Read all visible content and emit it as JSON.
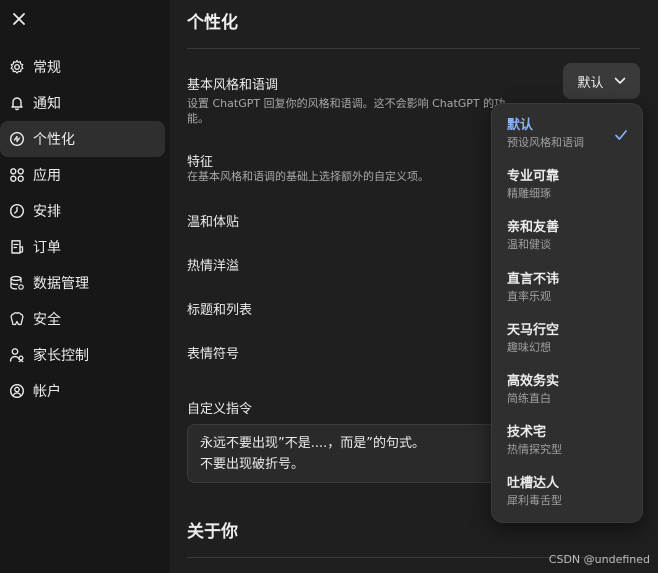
{
  "sidebar": {
    "close_icon": "close-icon",
    "items": [
      {
        "label": "常规",
        "icon": "gear-icon"
      },
      {
        "label": "通知",
        "icon": "bell-icon"
      },
      {
        "label": "个性化",
        "icon": "personalize-icon",
        "active": true
      },
      {
        "label": "应用",
        "icon": "apps-grid-icon"
      },
      {
        "label": "安排",
        "icon": "clock-icon"
      },
      {
        "label": "订单",
        "icon": "receipt-icon"
      },
      {
        "label": "数据管理",
        "icon": "database-icon"
      },
      {
        "label": "安全",
        "icon": "shield-icon"
      },
      {
        "label": "家长控制",
        "icon": "parent-control-icon"
      },
      {
        "label": "帐户",
        "icon": "user-circle-icon"
      }
    ]
  },
  "main": {
    "title": "个性化",
    "style": {
      "label": "基本风格和语调",
      "desc": "设置 ChatGPT 回复你的风格和语调。这不会影响 ChatGPT 的功能。",
      "selected": "默认"
    },
    "traits": {
      "label": "特征",
      "desc": "在基本风格和语调的基础上选择额外的自定义项。"
    },
    "trait_items": [
      "温和体贴",
      "热情洋溢",
      "标题和列表",
      "表情符号"
    ],
    "custom": {
      "label": "自定义指令",
      "lines": [
        "永远不要出现”不是....，而是”的句式。",
        "不要出现破折号。"
      ]
    },
    "about": "关于你"
  },
  "dropdown": {
    "options": [
      {
        "title": "默认",
        "sub": "预设风格和语调",
        "selected": true
      },
      {
        "title": "专业可靠",
        "sub": "精雕细琢"
      },
      {
        "title": "亲和友善",
        "sub": "温和健谈"
      },
      {
        "title": "直言不讳",
        "sub": "直率乐观"
      },
      {
        "title": "天马行空",
        "sub": "趣味幻想"
      },
      {
        "title": "高效务实",
        "sub": "简练直白"
      },
      {
        "title": "技术宅",
        "sub": "热情探究型"
      },
      {
        "title": "吐槽达人",
        "sub": "犀利毒舌型"
      }
    ]
  },
  "watermark": "CSDN @undefined",
  "colors": {
    "accent": "#8ab4ff",
    "bg": "#1f1f1f",
    "sidebar": "#171717"
  }
}
